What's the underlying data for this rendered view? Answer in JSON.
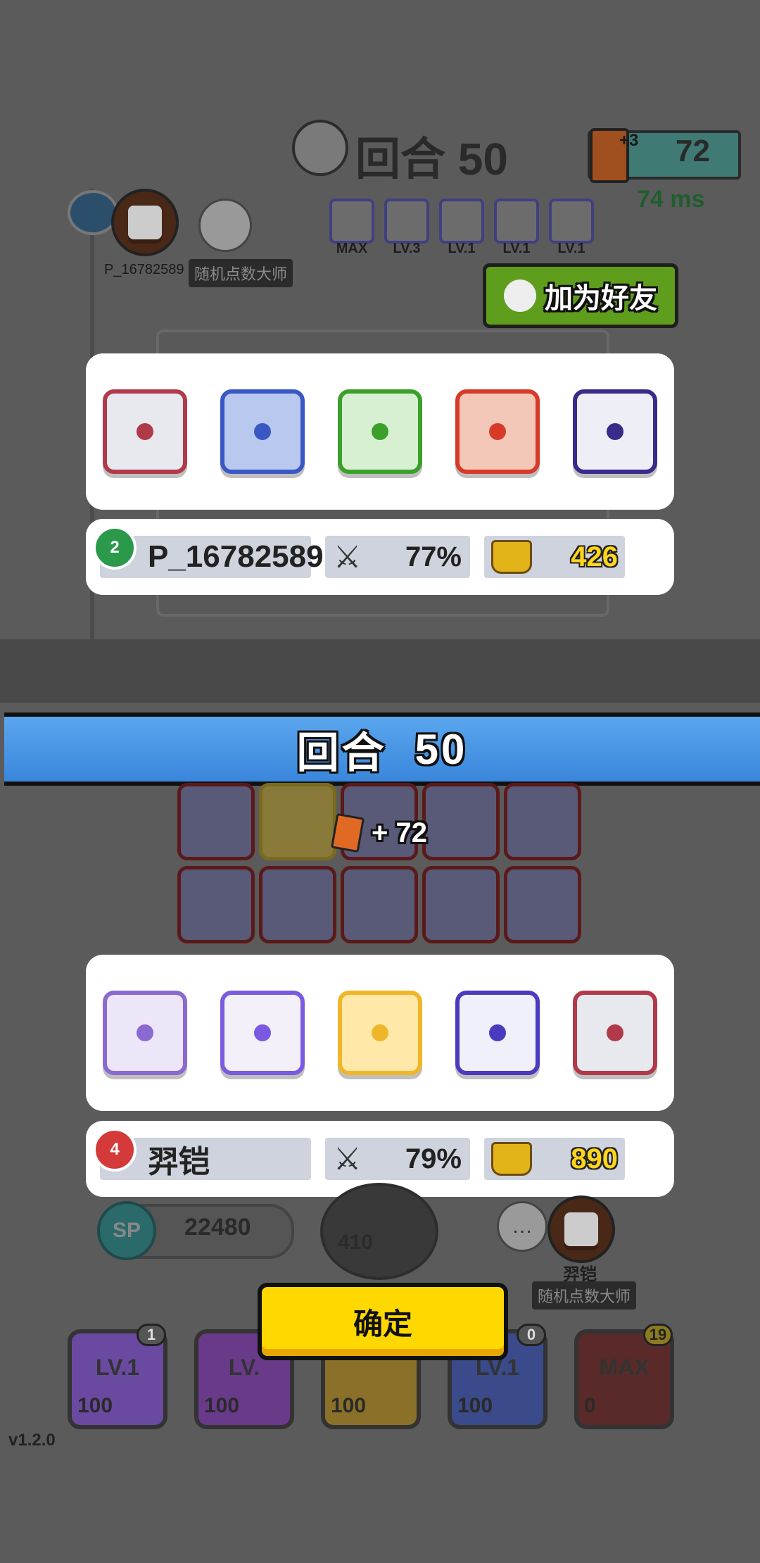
{
  "header": {
    "round_label": "回合 50",
    "cards": "72",
    "card_bonus": "+3",
    "ping": "74 ms"
  },
  "opponent": {
    "name": "P_16782589",
    "title": "随机点数大师",
    "rank": "2",
    "win_rate": "77%",
    "trophies": "426",
    "add_friend_label": "加为好友",
    "mini_dice_levels": [
      "MAX",
      "LV.3",
      "LV.1",
      "LV.1",
      "LV.1"
    ],
    "dice": [
      {
        "name": "storm-die",
        "color": "#b03a4a",
        "bg": "#e8e8ef"
      },
      {
        "name": "gear-die",
        "color": "#3a58c4",
        "bg": "#b8c8ee"
      },
      {
        "name": "poison-die",
        "color": "#3aa02a",
        "bg": "#d8f0d2"
      },
      {
        "name": "fire-die",
        "color": "#d83a2a",
        "bg": "#f4c8b8"
      },
      {
        "name": "wind-die",
        "color": "#3a2a8a",
        "bg": "#eeeef6"
      }
    ]
  },
  "banner": {
    "round_word": "回合",
    "round_number": "50"
  },
  "gain": {
    "label": "+ 72"
  },
  "player": {
    "name": "羿铠",
    "title": "随机点数大师",
    "rank": "4",
    "win_rate": "79%",
    "trophies": "890",
    "sp": "22480",
    "spawn_cost": "410",
    "dice": [
      {
        "name": "lightning-die",
        "color": "#8a6ad0",
        "bg": "#ece6f8"
      },
      {
        "name": "rainbow-die",
        "color": "#7a5ae0",
        "bg": "#f4f0fa"
      },
      {
        "name": "golden-die",
        "color": "#f0b62a",
        "bg": "#ffe8a8"
      },
      {
        "name": "blessing-die",
        "color": "#4a3ac0",
        "bg": "#f0f0fa"
      },
      {
        "name": "storm-die",
        "color": "#b03a4a",
        "bg": "#e8e8ef"
      }
    ],
    "upgrades": [
      {
        "level": "LV.1",
        "cost": "100",
        "badge": "1",
        "color": "#6a4aa0"
      },
      {
        "level": "LV.",
        "cost": "100",
        "badge": "",
        "color": "#6a3a8a"
      },
      {
        "level": "",
        "cost": "100",
        "badge": "",
        "color": "#8a7028"
      },
      {
        "level": "LV.1",
        "cost": "100",
        "badge": "0",
        "color": "#3a4a8a"
      },
      {
        "level": "MAX",
        "cost": "0",
        "badge": "19",
        "color": "#5a2a2a"
      }
    ]
  },
  "confirm_label": "确定",
  "version": "v1.2.0",
  "sp_label": "SP"
}
